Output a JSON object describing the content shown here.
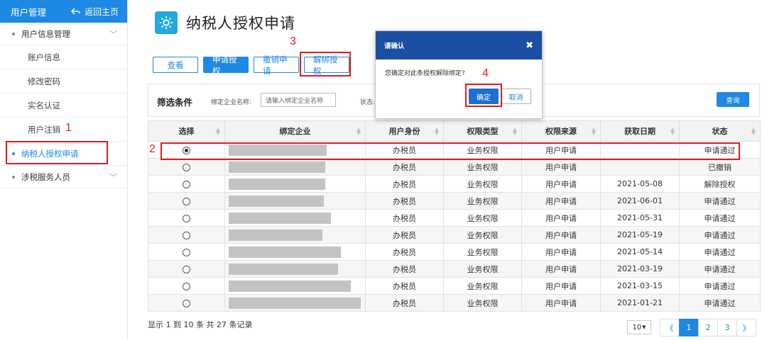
{
  "sidebar": {
    "header": "用户管理",
    "back": "返回主页",
    "groups": [
      {
        "label": "用户信息管理",
        "items": [
          "账户信息",
          "修改密码",
          "实名认证",
          "用户注销"
        ]
      }
    ],
    "active_item": "纳税人授权申请",
    "group2": "涉税服务人员"
  },
  "page": {
    "title": "纳税人授权申请"
  },
  "toolbar": {
    "view": "查看",
    "apply": "申请授权",
    "revoke": "撤销申请",
    "unbind": "解绑授权"
  },
  "filter": {
    "title": "筛选条件",
    "company_label": "绑定企业名称:",
    "company_placeholder": "请输入绑定企业名称",
    "status_label": "状态:",
    "query": "查询"
  },
  "table": {
    "headers": [
      "选择",
      "绑定企业",
      "用户身份",
      "权限类型",
      "权限来源",
      "获取日期",
      "状态"
    ],
    "rows": [
      {
        "selected": true,
        "identity": "办税员",
        "perm_type": "业务权限",
        "source": "用户申请",
        "date": "",
        "status": "申请通过"
      },
      {
        "selected": false,
        "identity": "办税员",
        "perm_type": "业务权限",
        "source": "用户申请",
        "date": "",
        "status": "已撤销"
      },
      {
        "selected": false,
        "identity": "办税员",
        "perm_type": "业务权限",
        "source": "用户申请",
        "date": "2021-05-08",
        "status": "解除授权"
      },
      {
        "selected": false,
        "identity": "办税员",
        "perm_type": "业务权限",
        "source": "用户申请",
        "date": "2021-06-01",
        "status": "申请通过"
      },
      {
        "selected": false,
        "identity": "办税员",
        "perm_type": "业务权限",
        "source": "用户申请",
        "date": "2021-05-31",
        "status": "申请通过"
      },
      {
        "selected": false,
        "identity": "办税员",
        "perm_type": "业务权限",
        "source": "用户申请",
        "date": "2021-05-19",
        "status": "申请通过"
      },
      {
        "selected": false,
        "identity": "办税员",
        "perm_type": "业务权限",
        "source": "用户申请",
        "date": "2021-05-14",
        "status": "申请通过"
      },
      {
        "selected": false,
        "identity": "办税员",
        "perm_type": "业务权限",
        "source": "用户申请",
        "date": "2021-03-19",
        "status": "申请通过"
      },
      {
        "selected": false,
        "identity": "办税员",
        "perm_type": "业务权限",
        "source": "用户申请",
        "date": "2021-03-15",
        "status": "申请通过"
      },
      {
        "selected": false,
        "identity": "办税员",
        "perm_type": "业务权限",
        "source": "用户申请",
        "date": "2021-01-21",
        "status": "申请通过"
      }
    ]
  },
  "footer": {
    "info": "显示 1 到 10 条 共 27 条记录",
    "page_size": "10",
    "pages": [
      "《",
      "1",
      "2",
      "3",
      "》"
    ],
    "current_page": "1"
  },
  "dialog": {
    "title": "请确认",
    "message": "您确定对此条授权解除绑定?",
    "ok": "确定",
    "cancel": "取消"
  },
  "annotations": [
    "1",
    "2",
    "3",
    "4"
  ],
  "colors": {
    "primary": "#1e88e5",
    "dialog_header": "#1a4fa3",
    "annotation": "#e31b1b"
  }
}
